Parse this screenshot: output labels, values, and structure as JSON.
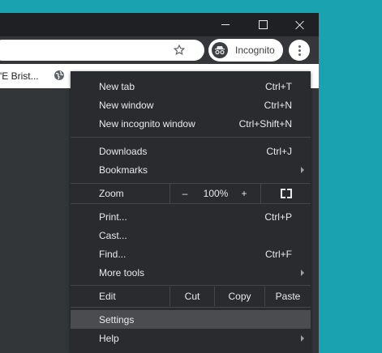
{
  "toolbar": {
    "profile_label": "Incognito"
  },
  "bookmarks_bar": {
    "item_label": "'E Brist..."
  },
  "menu": {
    "items_top": [
      {
        "label": "New tab",
        "shortcut": "Ctrl+T"
      },
      {
        "label": "New window",
        "shortcut": "Ctrl+N"
      },
      {
        "label": "New incognito window",
        "shortcut": "Ctrl+Shift+N"
      }
    ],
    "items_mid": [
      {
        "label": "Downloads",
        "shortcut": "Ctrl+J"
      },
      {
        "label": "Bookmarks",
        "shortcut": ""
      }
    ],
    "zoom": {
      "label": "Zoom",
      "minus": "–",
      "value": "100%",
      "plus": "+"
    },
    "items_tools": [
      {
        "label": "Print...",
        "shortcut": "Ctrl+P"
      },
      {
        "label": "Cast...",
        "shortcut": ""
      },
      {
        "label": "Find...",
        "shortcut": "Ctrl+F"
      },
      {
        "label": "More tools",
        "shortcut": ""
      }
    ],
    "edit": {
      "label": "Edit",
      "cut": "Cut",
      "copy": "Copy",
      "paste": "Paste"
    },
    "items_bottom": [
      {
        "label": "Settings",
        "shortcut": ""
      },
      {
        "label": "Help",
        "shortcut": ""
      }
    ]
  },
  "colors": {
    "desktop": "#1aa2b0",
    "menu_bg": "#2a2b2e",
    "menu_text": "#e8eaed",
    "highlight": "#4a4c50"
  }
}
